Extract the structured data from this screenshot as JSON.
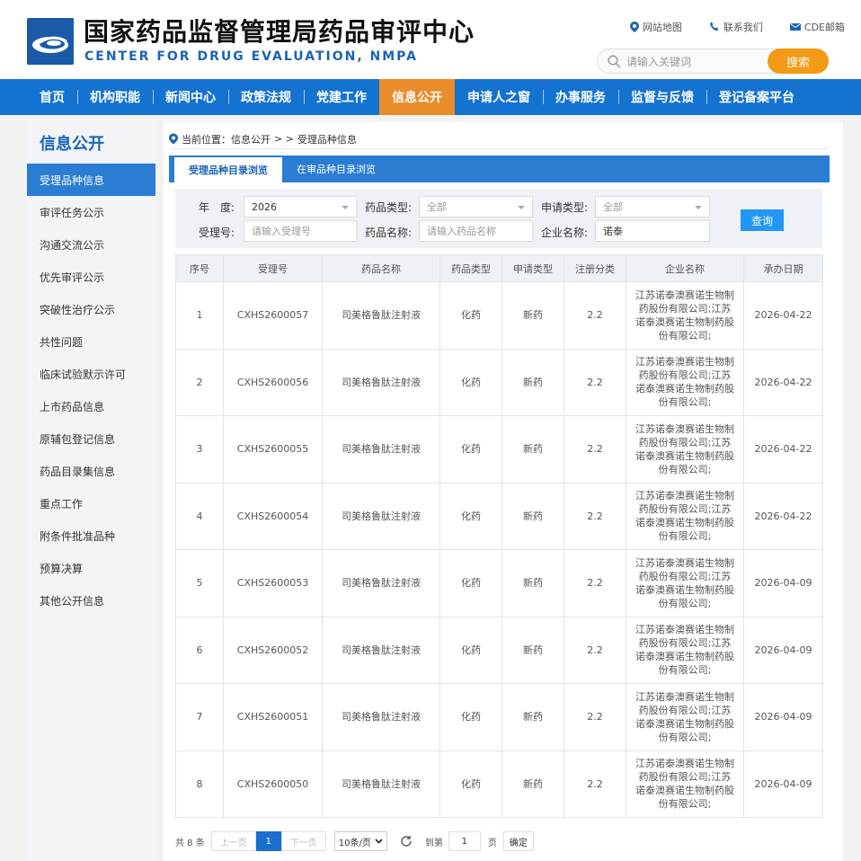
{
  "header": {
    "title": "国家药品监督管理局药品审评中心",
    "subtitle": "CENTER FOR DRUG EVALUATION, NMPA",
    "links": [
      "网站地图",
      "联系我们",
      "CDE邮箱"
    ],
    "search_placeholder": "请输入关键词",
    "search_button": "搜索"
  },
  "nav": [
    "首页",
    "机构职能",
    "新闻中心",
    "政策法规",
    "党建工作",
    "信息公开",
    "申请人之窗",
    "办事服务",
    "监督与反馈",
    "登记备案平台"
  ],
  "sidebar": {
    "title": "信息公开",
    "items": [
      "受理品种信息",
      "审评任务公示",
      "沟通交流公示",
      "优先审评公示",
      "突破性治疗公示",
      "共性问题",
      "临床试验默示许可",
      "上市药品信息",
      "原辅包登记信息",
      "药品目录集信息",
      "重点工作",
      "附条件批准品种",
      "预算决算",
      "其他公开信息"
    ]
  },
  "breadcrumb": {
    "prefix": "当前位置：信息公开",
    "sep": "> >",
    "current": "受理品种信息"
  },
  "tabs": [
    "受理品种目录浏览",
    "在审品种目录浏览"
  ],
  "filter": {
    "year_label": "年　度:",
    "year_value": "2026",
    "drug_type_label": "药品类型:",
    "drug_type_value": "全部",
    "apply_type_label": "申请类型:",
    "apply_type_value": "全部",
    "accept_no_label": "受理号:",
    "accept_no_placeholder": "请输入受理号",
    "drug_name_label": "药品名称:",
    "drug_name_placeholder": "请输入药品名称",
    "company_label": "企业名称:",
    "company_value": "诺泰",
    "query_button": "查询"
  },
  "table": {
    "columns": [
      "序号",
      "受理号",
      "药品名称",
      "药品类型",
      "申请类型",
      "注册分类",
      "企业名称",
      "承办日期"
    ],
    "rows": [
      [
        "1",
        "CXHS2600057",
        "司美格鲁肽注射液",
        "化药",
        "新药",
        "2.2",
        "江苏诺泰澳赛诺生物制药股份有限公司;江苏诺泰澳赛诺生物制药股份有限公司;",
        "2026-04-22"
      ],
      [
        "2",
        "CXHS2600056",
        "司美格鲁肽注射液",
        "化药",
        "新药",
        "2.2",
        "江苏诺泰澳赛诺生物制药股份有限公司;江苏诺泰澳赛诺生物制药股份有限公司;",
        "2026-04-22"
      ],
      [
        "3",
        "CXHS2600055",
        "司美格鲁肽注射液",
        "化药",
        "新药",
        "2.2",
        "江苏诺泰澳赛诺生物制药股份有限公司;江苏诺泰澳赛诺生物制药股份有限公司;",
        "2026-04-22"
      ],
      [
        "4",
        "CXHS2600054",
        "司美格鲁肽注射液",
        "化药",
        "新药",
        "2.2",
        "江苏诺泰澳赛诺生物制药股份有限公司;江苏诺泰澳赛诺生物制药股份有限公司;",
        "2026-04-22"
      ],
      [
        "5",
        "CXHS2600053",
        "司美格鲁肽注射液",
        "化药",
        "新药",
        "2.2",
        "江苏诺泰澳赛诺生物制药股份有限公司;江苏诺泰澳赛诺生物制药股份有限公司;",
        "2026-04-09"
      ],
      [
        "6",
        "CXHS2600052",
        "司美格鲁肽注射液",
        "化药",
        "新药",
        "2.2",
        "江苏诺泰澳赛诺生物制药股份有限公司;江苏诺泰澳赛诺生物制药股份有限公司;",
        "2026-04-09"
      ],
      [
        "7",
        "CXHS2600051",
        "司美格鲁肽注射液",
        "化药",
        "新药",
        "2.2",
        "江苏诺泰澳赛诺生物制药股份有限公司;江苏诺泰澳赛诺生物制药股份有限公司;",
        "2026-04-09"
      ],
      [
        "8",
        "CXHS2600050",
        "司美格鲁肽注射液",
        "化药",
        "新药",
        "2.2",
        "江苏诺泰澳赛诺生物制药股份有限公司;江苏诺泰澳赛诺生物制药股份有限公司;",
        "2026-04-09"
      ]
    ]
  },
  "pager": {
    "total": "共 8 条",
    "prev": "上一页",
    "current": "1",
    "next": "下一页",
    "page_size": "10条/页",
    "goto_label": "到第",
    "goto_value": "1",
    "page_unit": "页",
    "confirm": "确定"
  },
  "colors": {
    "primary": "#1472d1",
    "accent": "#e88d2a",
    "search": "#f39a16"
  }
}
